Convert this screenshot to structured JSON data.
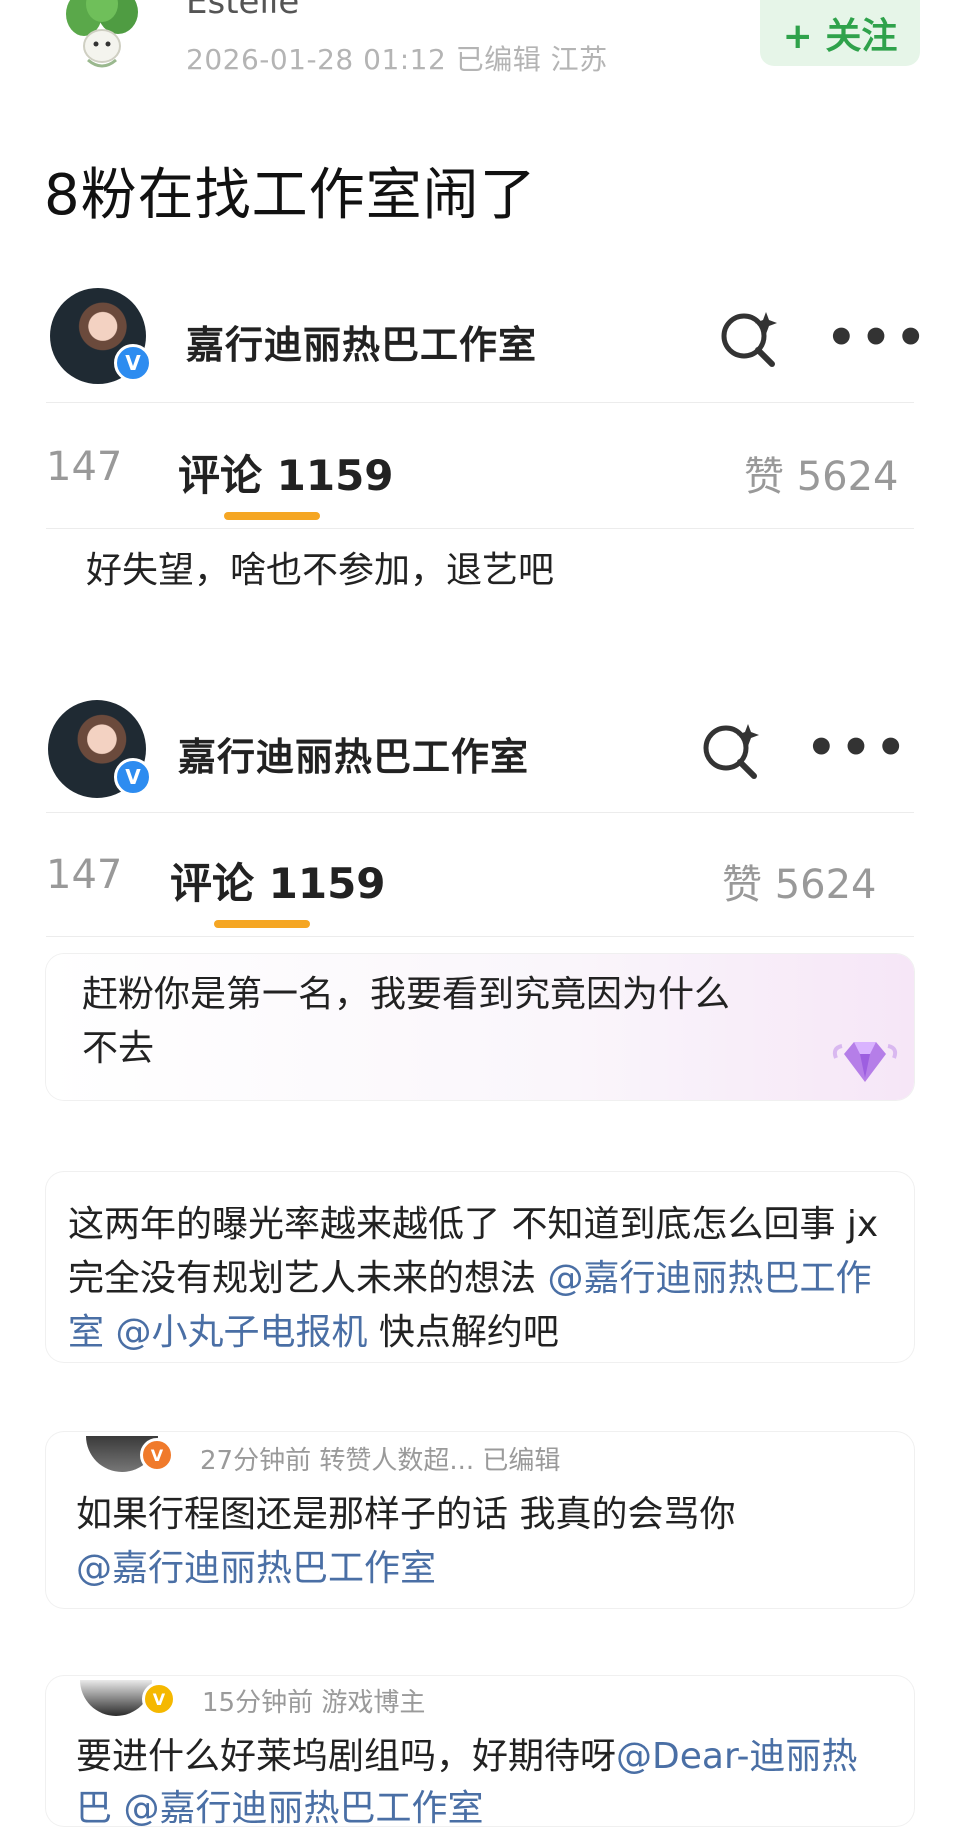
{
  "post": {
    "author": "Estelle",
    "meta": "2026-01-28 01:12  已编辑  江苏",
    "follow_label": "+ 关注",
    "title": "8粉在找工作室闹了"
  },
  "card1": {
    "studio_name": "嘉行迪丽热巴工作室",
    "verified_mark": "V",
    "more": "•••",
    "tab_left": "147",
    "tab_active": "评论 1159",
    "likes": "赞 5624",
    "comment": "好失望，啥也不参加，退艺吧"
  },
  "card2": {
    "studio_name": "嘉行迪丽热巴工作室",
    "verified_mark": "V",
    "more": "•••",
    "tab_left": "147",
    "tab_active": "评论 1159",
    "likes": "赞 5624",
    "comment_line1": "赶粉你是第一名，我要看到究竟因为什么",
    "comment_line2": "不去"
  },
  "comment3": {
    "line1": "这两年的曝光率越来越低了 不知道到底怎么回事 jx",
    "line2_text": "完全没有规划艺人未来的想法 ",
    "line2_mention": "@嘉行迪丽热巴工作",
    "line3_mention1": "室 ",
    "line3_mention2": "@小丸子电报机",
    "line3_text": " 快点解约吧"
  },
  "comment4": {
    "badge": "V",
    "meta": "27分钟前  转赞人数超...  已编辑",
    "line1": "如果行程图还是那样子的话 我真的会骂你",
    "mention": "@嘉行迪丽热巴工作室"
  },
  "comment5": {
    "badge": "V",
    "meta": "15分钟前   游戏博主",
    "line1_text": "要进什么好莱坞剧组吗，好期待呀",
    "line1_mention": "@Dear-迪丽热",
    "line2": "巴 @嘉行迪丽热巴工作室"
  },
  "colors": {
    "follow_text": "#2fa24b",
    "follow_bg": "#e6f5e8",
    "tab_underline": "#f5a623",
    "mention": "#4a6fa5",
    "verified_blue": "#2d8cf0"
  },
  "icons": [
    "plant-logo-icon",
    "search-spark-icon",
    "more-icon",
    "gem-icon",
    "verified-icon"
  ]
}
